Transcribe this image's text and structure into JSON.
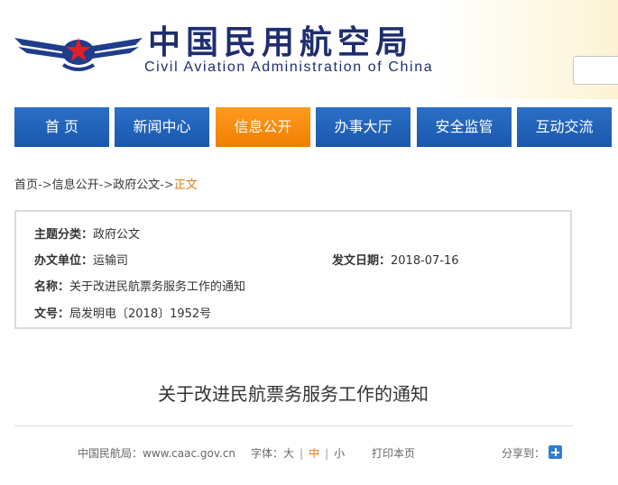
{
  "header": {
    "title_cn": "中国民用航空局",
    "title_en": "Civil Aviation Administration of China",
    "logo_icon": "caac-wings-star-logo-icon"
  },
  "nav": {
    "items": [
      {
        "label": "首 页",
        "active": false
      },
      {
        "label": "新闻中心",
        "active": false
      },
      {
        "label": "信息公开",
        "active": true
      },
      {
        "label": "办事大厅",
        "active": false
      },
      {
        "label": "安全监管",
        "active": false
      },
      {
        "label": "互动交流",
        "active": false
      }
    ]
  },
  "breadcrumb": {
    "home": "首页",
    "info": "信息公开",
    "docs": "政府公文",
    "current": "正文",
    "separator": "->"
  },
  "info": {
    "category_label": "主题分类：",
    "category_value": "政府公文",
    "issuer_label": "办文单位：",
    "issuer_value": "运输司",
    "date_label": "发文日期：",
    "date_value": "2018-07-16",
    "name_label": "名称：",
    "name_value": "关于改进民航票务服务工作的通知",
    "number_label": "文号：",
    "number_value": "局发明电〔2018〕1952号"
  },
  "article": {
    "title": "关于改进民航票务服务工作的通知"
  },
  "tools": {
    "site": "中国民航局：www.caac.gov.cn",
    "font_label": "字体：",
    "font_large": "大",
    "font_medium": "中",
    "font_small": "小",
    "separator": "|",
    "print": "打印本页",
    "share": "分享到："
  },
  "colors": {
    "nav_blue": "#1f62b8",
    "nav_active_orange": "#f5890e",
    "brand_navy": "#1f2e6e",
    "breadcrumb_current": "#e77817"
  }
}
